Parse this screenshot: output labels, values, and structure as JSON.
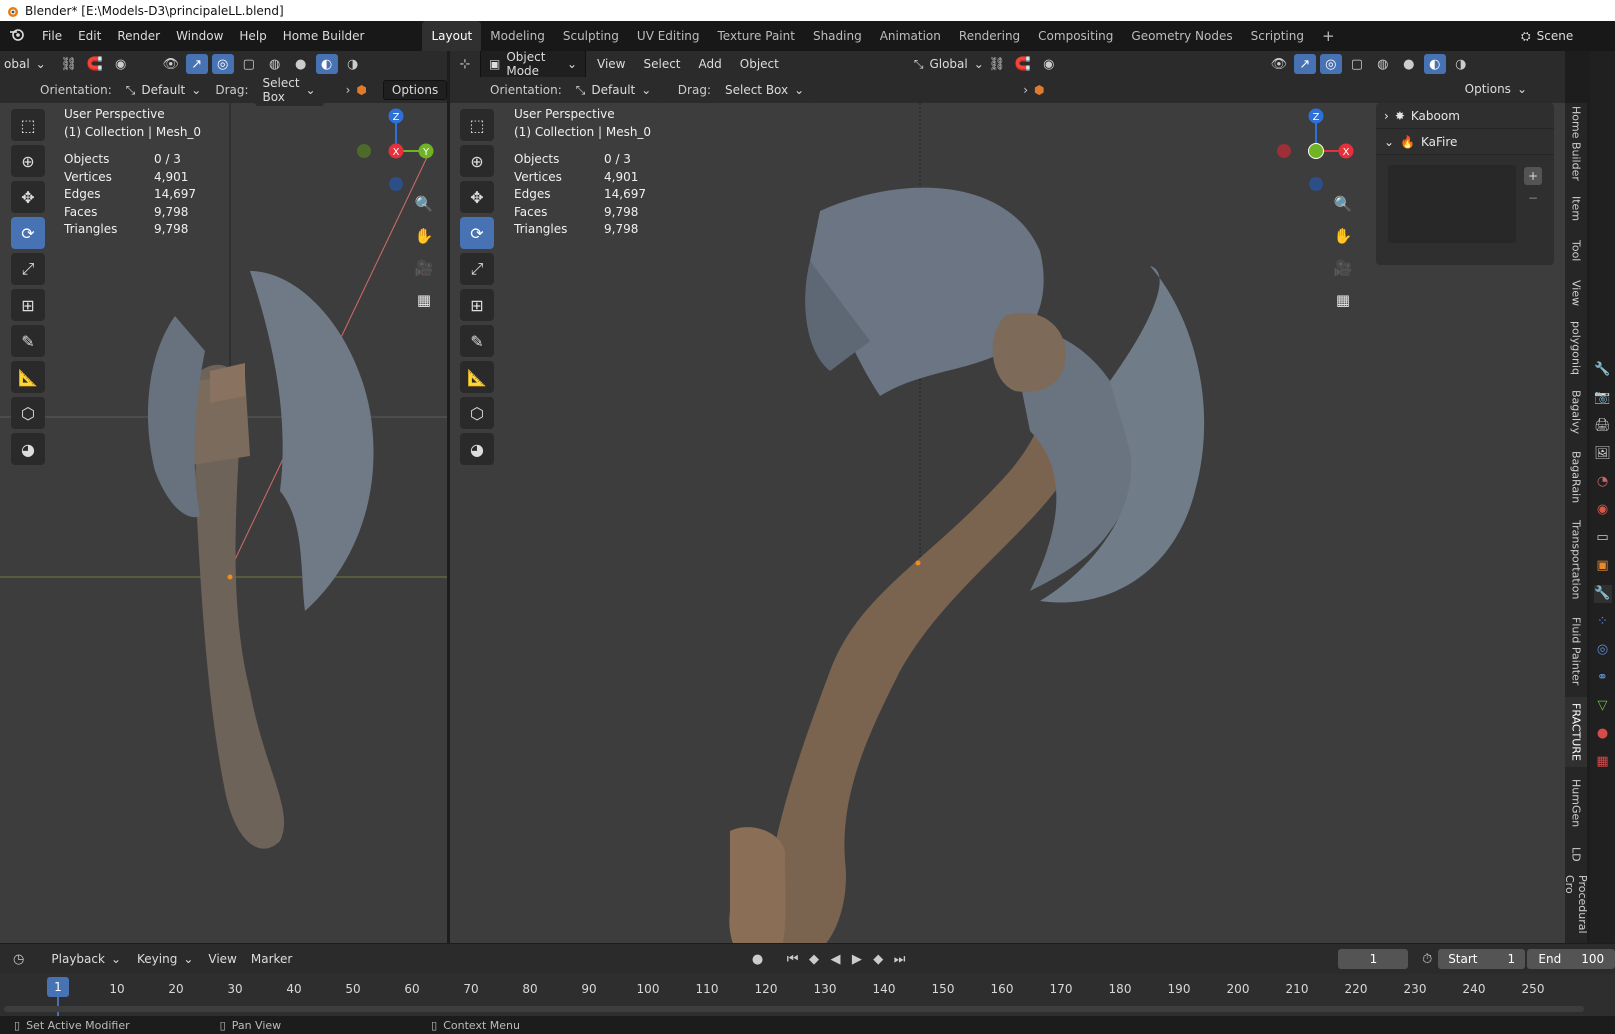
{
  "window_title": "Blender* [E:\\Models-D3\\principaleLL.blend]",
  "menu": [
    "File",
    "Edit",
    "Render",
    "Window",
    "Help",
    "Home Builder"
  ],
  "workspaces": [
    "Layout",
    "Modeling",
    "Sculpting",
    "UV Editing",
    "Texture Paint",
    "Shading",
    "Animation",
    "Rendering",
    "Compositing",
    "Geometry Nodes",
    "Scripting"
  ],
  "active_workspace": "Layout",
  "scene_label": "Scene",
  "left_viewport": {
    "transform_partial": "obal",
    "orientation_label": "Orientation:",
    "orientation_value": "Default",
    "drag_label": "Drag:",
    "drag_value": "Select Box",
    "options_label": "Options",
    "perspective": "User Perspective",
    "collection": "(1) Collection | Mesh_0",
    "stats": [
      {
        "k": "Objects",
        "v": "0 / 3"
      },
      {
        "k": "Vertices",
        "v": "4,901"
      },
      {
        "k": "Edges",
        "v": "14,697"
      },
      {
        "k": "Faces",
        "v": "9,798"
      },
      {
        "k": "Triangles",
        "v": "9,798"
      }
    ]
  },
  "right_viewport": {
    "mode": "Object Mode",
    "menus": [
      "View",
      "Select",
      "Add",
      "Object"
    ],
    "transform": "Global",
    "orientation_label": "Orientation:",
    "orientation_value": "Default",
    "drag_label": "Drag:",
    "drag_value": "Select Box",
    "options_label": "Options",
    "perspective": "User Perspective",
    "collection": "(1) Collection | Mesh_0",
    "stats": [
      {
        "k": "Objects",
        "v": "0 / 3"
      },
      {
        "k": "Vertices",
        "v": "4,901"
      },
      {
        "k": "Edges",
        "v": "14,697"
      },
      {
        "k": "Faces",
        "v": "9,798"
      },
      {
        "k": "Triangles",
        "v": "9,798"
      }
    ]
  },
  "gizmo_axes": {
    "x": "X",
    "y": "Y",
    "z": "Z"
  },
  "npanel_addons": [
    "Kaboom",
    "KaFire"
  ],
  "sidebar_tabs": [
    "Home Builder",
    "Item",
    "Tool",
    "View",
    "polygoniq",
    "Bagalvy",
    "BagaRain",
    "Transportation",
    "Fluid Painter",
    "FRACTURE",
    "HumGen",
    "LD",
    "Procedural Cro"
  ],
  "timeline": {
    "menus": [
      "Playback",
      "Keying",
      "View",
      "Marker"
    ],
    "current_frame": "1",
    "start_label": "Start",
    "start_value": "1",
    "end_label": "End",
    "end_value": "100",
    "frame_marker": "1",
    "frame_numbers": [
      "10",
      "20",
      "30",
      "40",
      "50",
      "60",
      "70",
      "80",
      "90",
      "100",
      "110",
      "120",
      "130",
      "140",
      "150",
      "160",
      "170",
      "180",
      "190",
      "200",
      "210",
      "220",
      "230",
      "240",
      "250"
    ]
  },
  "status": [
    "Set Active Modifier",
    "Pan View",
    "Context Menu"
  ],
  "colors": {
    "accent": "#4772b3",
    "x_axis": "#e8303c",
    "y_axis": "#70b324",
    "z_axis": "#2f6fd8",
    "viewport_bg": "#3d3d3d"
  }
}
